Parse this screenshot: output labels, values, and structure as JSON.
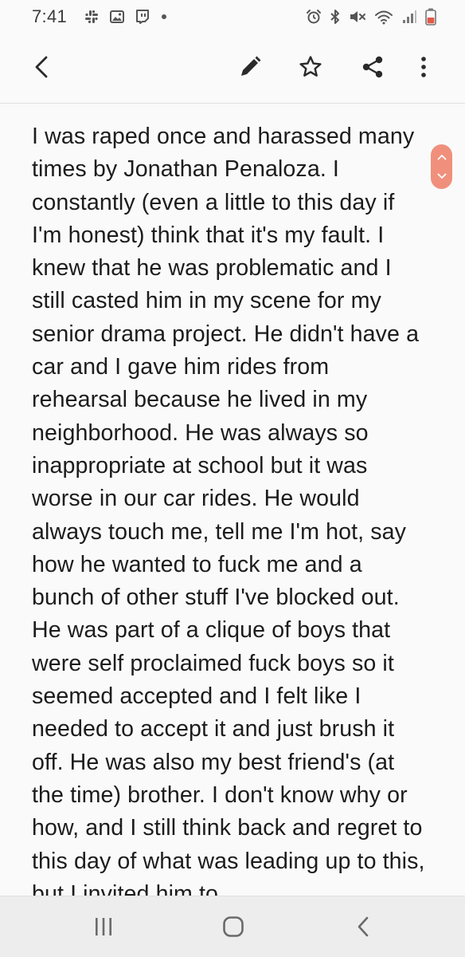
{
  "status_bar": {
    "time": "7:41",
    "notifications": [
      "slack-icon",
      "gallery-icon",
      "twitch-icon",
      "dot-icon"
    ],
    "system": [
      "alarm-icon",
      "bluetooth-icon",
      "mute-icon",
      "wifi-icon",
      "signal-icon",
      "battery-icon"
    ]
  },
  "toolbar": {
    "icons": [
      "back-arrow-icon",
      "pencil-icon",
      "star-icon",
      "share-icon",
      "more-vert-icon"
    ]
  },
  "note": {
    "body": "I was raped once and harassed many times by Jonathan Penaloza. I constantly (even a little to this day if I'm honest) think that it's my fault. I knew that he was problematic and I still casted him in my scene for my senior drama project. He didn't have a car and I gave him rides from rehearsal because he lived in my neighborhood. He was always so inappropriate at school but it was worse in our car rides. He would always touch me, tell me I'm hot, say how he wanted to fuck me and a bunch of other stuff I've blocked out. He was part of a clique of boys that were self proclaimed fuck boys so it seemed accepted and I felt like I needed to accept it and just brush it off. He was also my best friend's (at the time) brother. I don't know why or how, and I still think back and regret to this day of what was leading up to this, but I invited him to"
  },
  "scroll_pill": {
    "color": "#f0907c",
    "icons": [
      "chevron-up-icon",
      "chevron-down-icon"
    ]
  },
  "nav_bar": {
    "icons": [
      "recents-icon",
      "home-icon",
      "back-icon"
    ]
  }
}
